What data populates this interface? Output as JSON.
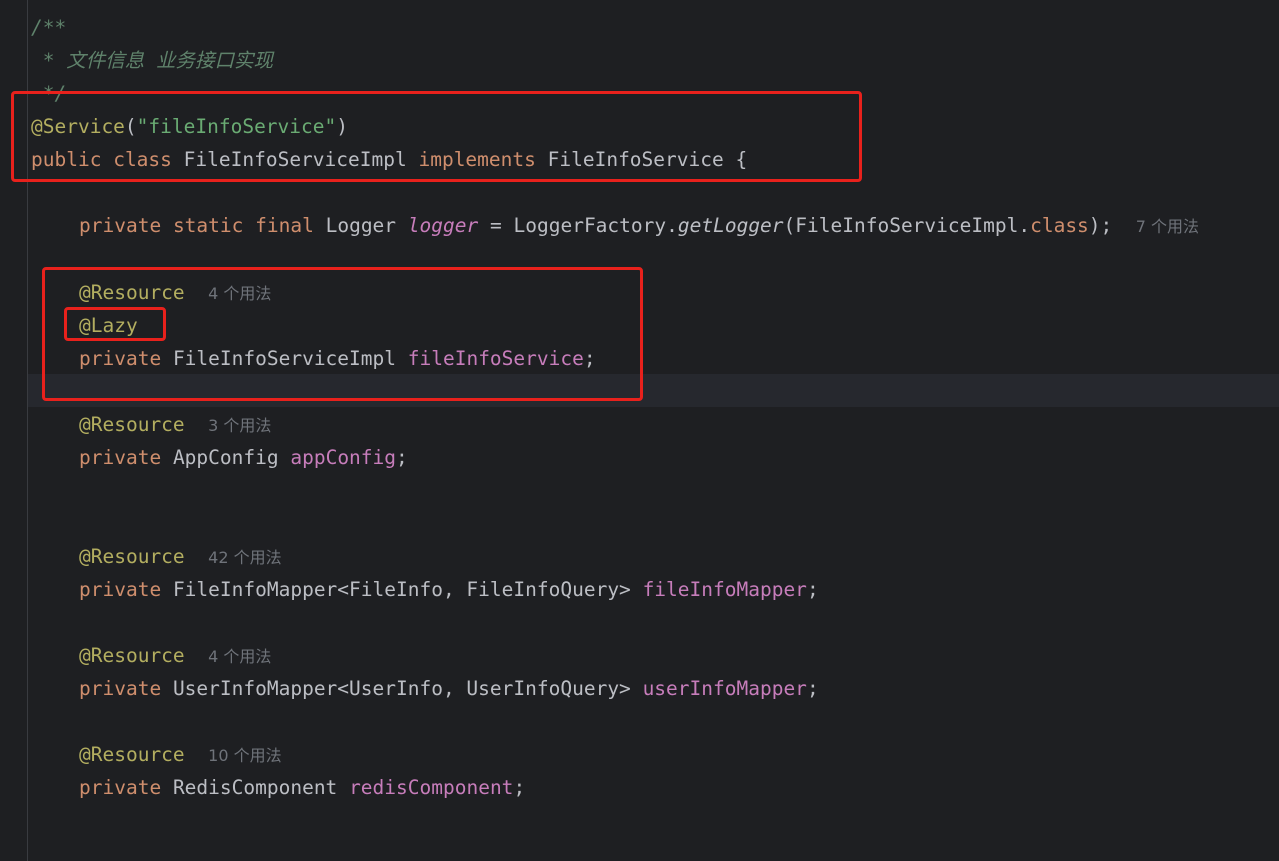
{
  "editor": {
    "doc_open": "/**",
    "doc_body": " * 文件信息 业务接口实现",
    "doc_close": " */",
    "service_annotation": "@Service",
    "service_paren_open": "(",
    "service_name": "\"fileInfoService\"",
    "service_paren_close": ")",
    "kw_public": "public",
    "kw_class": "class",
    "class_name": "FileInfoServiceImpl",
    "kw_implements": "implements",
    "interface_name": "FileInfoService",
    "brace_open": "{",
    "logger_line": {
      "kw_private": "private",
      "kw_static": "static",
      "kw_final": "final",
      "type": "Logger",
      "name": "logger",
      "assign": "=",
      "factory": "LoggerFactory.",
      "method": "getLogger",
      "arg_open": "(FileInfoServiceImpl.",
      "kw_class": "class",
      "arg_close": ");",
      "usages": "7 个用法"
    },
    "fields": [
      {
        "annotation": "@Resource",
        "usages": "4 个用法",
        "extra_annotation": "@Lazy",
        "kw_private": "private",
        "type": "FileInfoServiceImpl",
        "name": "fileInfoService",
        "semi": ";"
      },
      {
        "annotation": "@Resource",
        "usages": "3 个用法",
        "kw_private": "private",
        "type": "AppConfig",
        "name": "appConfig",
        "semi": ";"
      },
      {
        "annotation": "@Resource",
        "usages": "42 个用法",
        "kw_private": "private",
        "type": "FileInfoMapper<FileInfo, FileInfoQuery>",
        "name": "fileInfoMapper",
        "semi": ";"
      },
      {
        "annotation": "@Resource",
        "usages": "4 个用法",
        "kw_private": "private",
        "type": "UserInfoMapper<UserInfo, UserInfoQuery>",
        "name": "userInfoMapper",
        "semi": ";"
      },
      {
        "annotation": "@Resource",
        "usages": "10 个用法",
        "kw_private": "private",
        "type": "RedisComponent",
        "name": "redisComponent",
        "semi": ";"
      }
    ]
  },
  "colors": {
    "background": "#1e1f22",
    "keyword": "#cf8e6d",
    "annotation": "#b3ae60",
    "string": "#6aab73",
    "field": "#c77dbb",
    "doc_comment": "#5f826b",
    "highlight_box": "#e8211c"
  }
}
